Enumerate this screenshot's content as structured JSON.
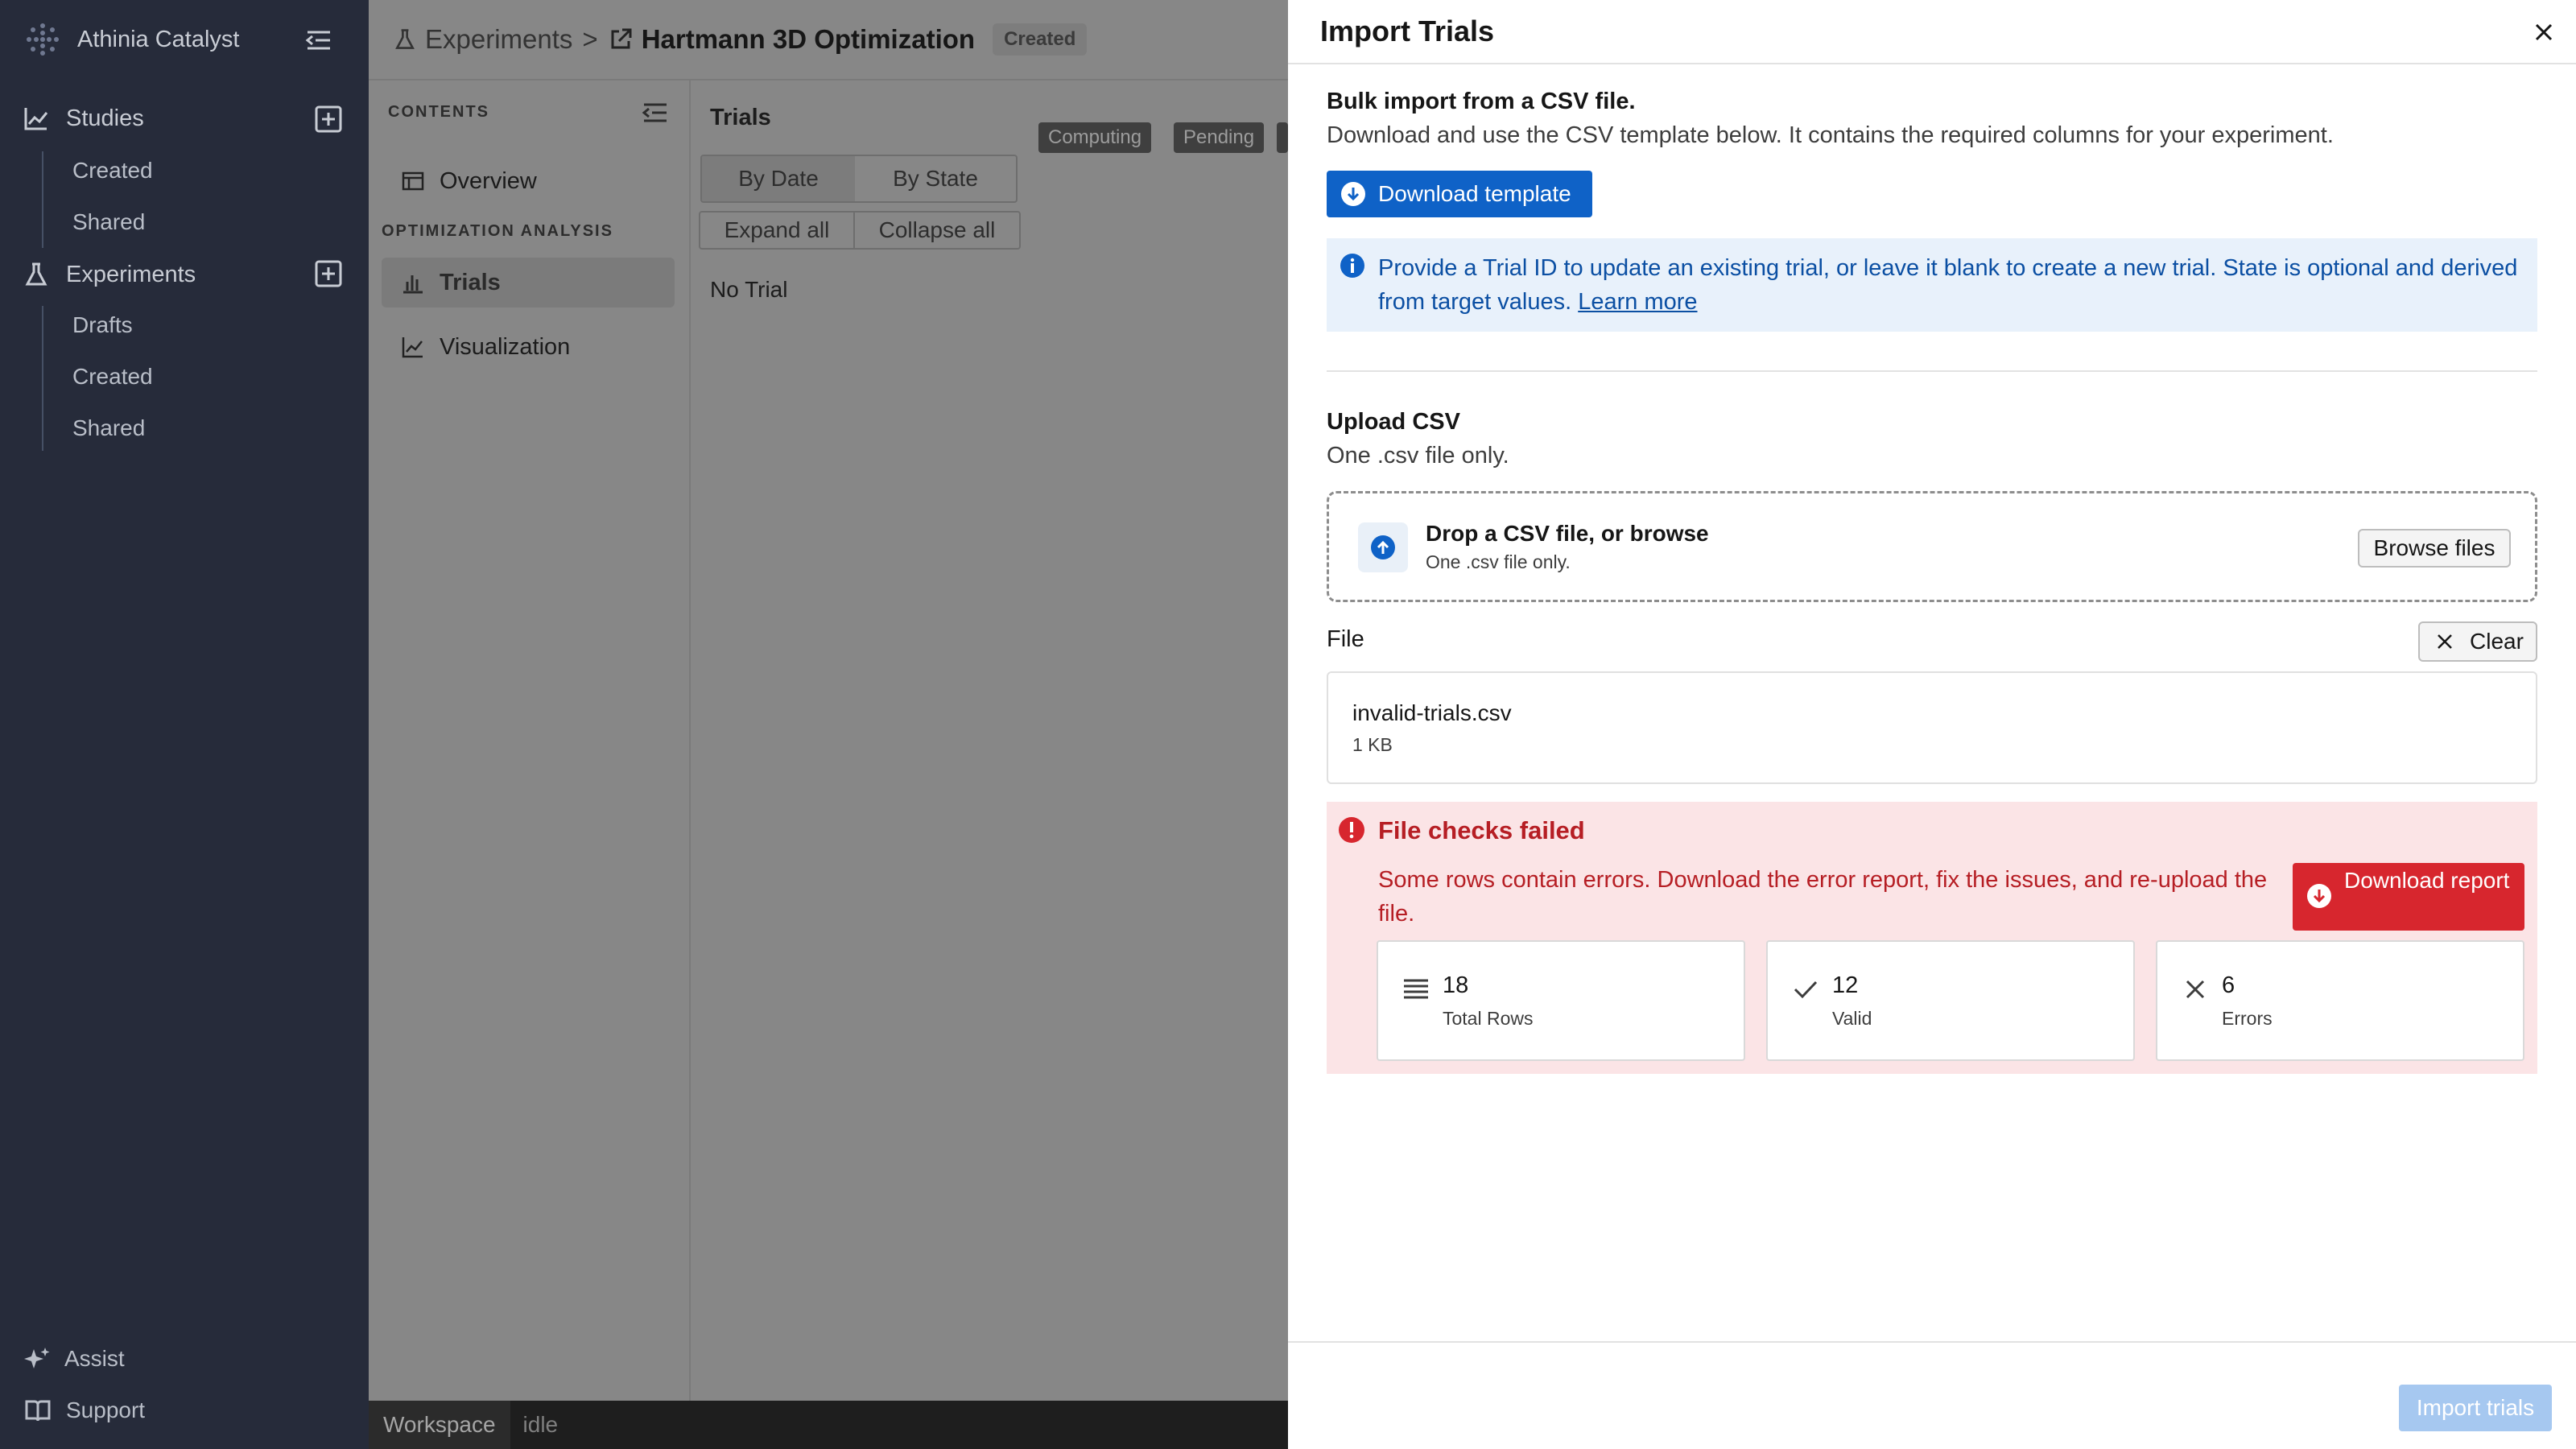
{
  "app": {
    "name": "Athinia Catalyst"
  },
  "sidebar": {
    "studies": {
      "label": "Studies",
      "items": [
        "Created",
        "Shared"
      ]
    },
    "experiments": {
      "label": "Experiments",
      "items": [
        "Drafts",
        "Created",
        "Shared"
      ]
    },
    "bottom": {
      "assist": "Assist",
      "support": "Support"
    }
  },
  "header": {
    "breadcrumb_root": "Experiments",
    "separator": ">",
    "experiment_title": "Hartmann 3D Optimization",
    "status_badge": "Created"
  },
  "contents": {
    "heading": "CONTENTS",
    "overview": "Overview",
    "section": "OPTIMIZATION ANALYSIS",
    "trials": "Trials",
    "visualization": "Visualization"
  },
  "trials": {
    "title": "Trials",
    "sort_options": [
      "By Date",
      "By State"
    ],
    "selected_sort": "By Date",
    "expand_all": "Expand all",
    "collapse_all": "Collapse all",
    "chips": [
      "Computing",
      "Pending"
    ],
    "empty": "No Trial"
  },
  "statusbar": {
    "workspace": "Workspace",
    "state": "idle"
  },
  "modal": {
    "title": "Import Trials",
    "bulk": {
      "title": "Bulk import from a CSV file.",
      "desc": "Download and use the CSV template below. It contains the required columns for your experiment.",
      "download_template": "Download template"
    },
    "info": {
      "text": "Provide a Trial ID to update an existing trial, or leave it blank to create a new trial. State is optional and derived from target values.",
      "link": "Learn more"
    },
    "upload": {
      "title": "Upload CSV",
      "desc": "One .csv file only.",
      "drop_title": "Drop a CSV file, or browse",
      "drop_sub": "One .csv file only.",
      "browse": "Browse files"
    },
    "file": {
      "label": "File",
      "clear": "Clear",
      "name": "invalid-trials.csv",
      "size": "1 KB"
    },
    "errors": {
      "title": "File checks failed",
      "text": "Some rows contain errors. Download the error report, fix the issues, and re-upload the file.",
      "download_report": "Download report",
      "stats": [
        {
          "value": "18",
          "label": "Total Rows",
          "icon": "list-icon"
        },
        {
          "value": "12",
          "label": "Valid",
          "icon": "check-icon"
        },
        {
          "value": "6",
          "label": "Errors",
          "icon": "x-icon"
        }
      ]
    },
    "footer": {
      "import": "Import trials"
    }
  },
  "colors": {
    "sidebar_bg": "#262b3a",
    "primary": "#0f62c7",
    "danger": "#d7262e",
    "error_bg": "#fbe4e6",
    "info_bg": "#e8f1fb",
    "overlay": "#878787"
  }
}
